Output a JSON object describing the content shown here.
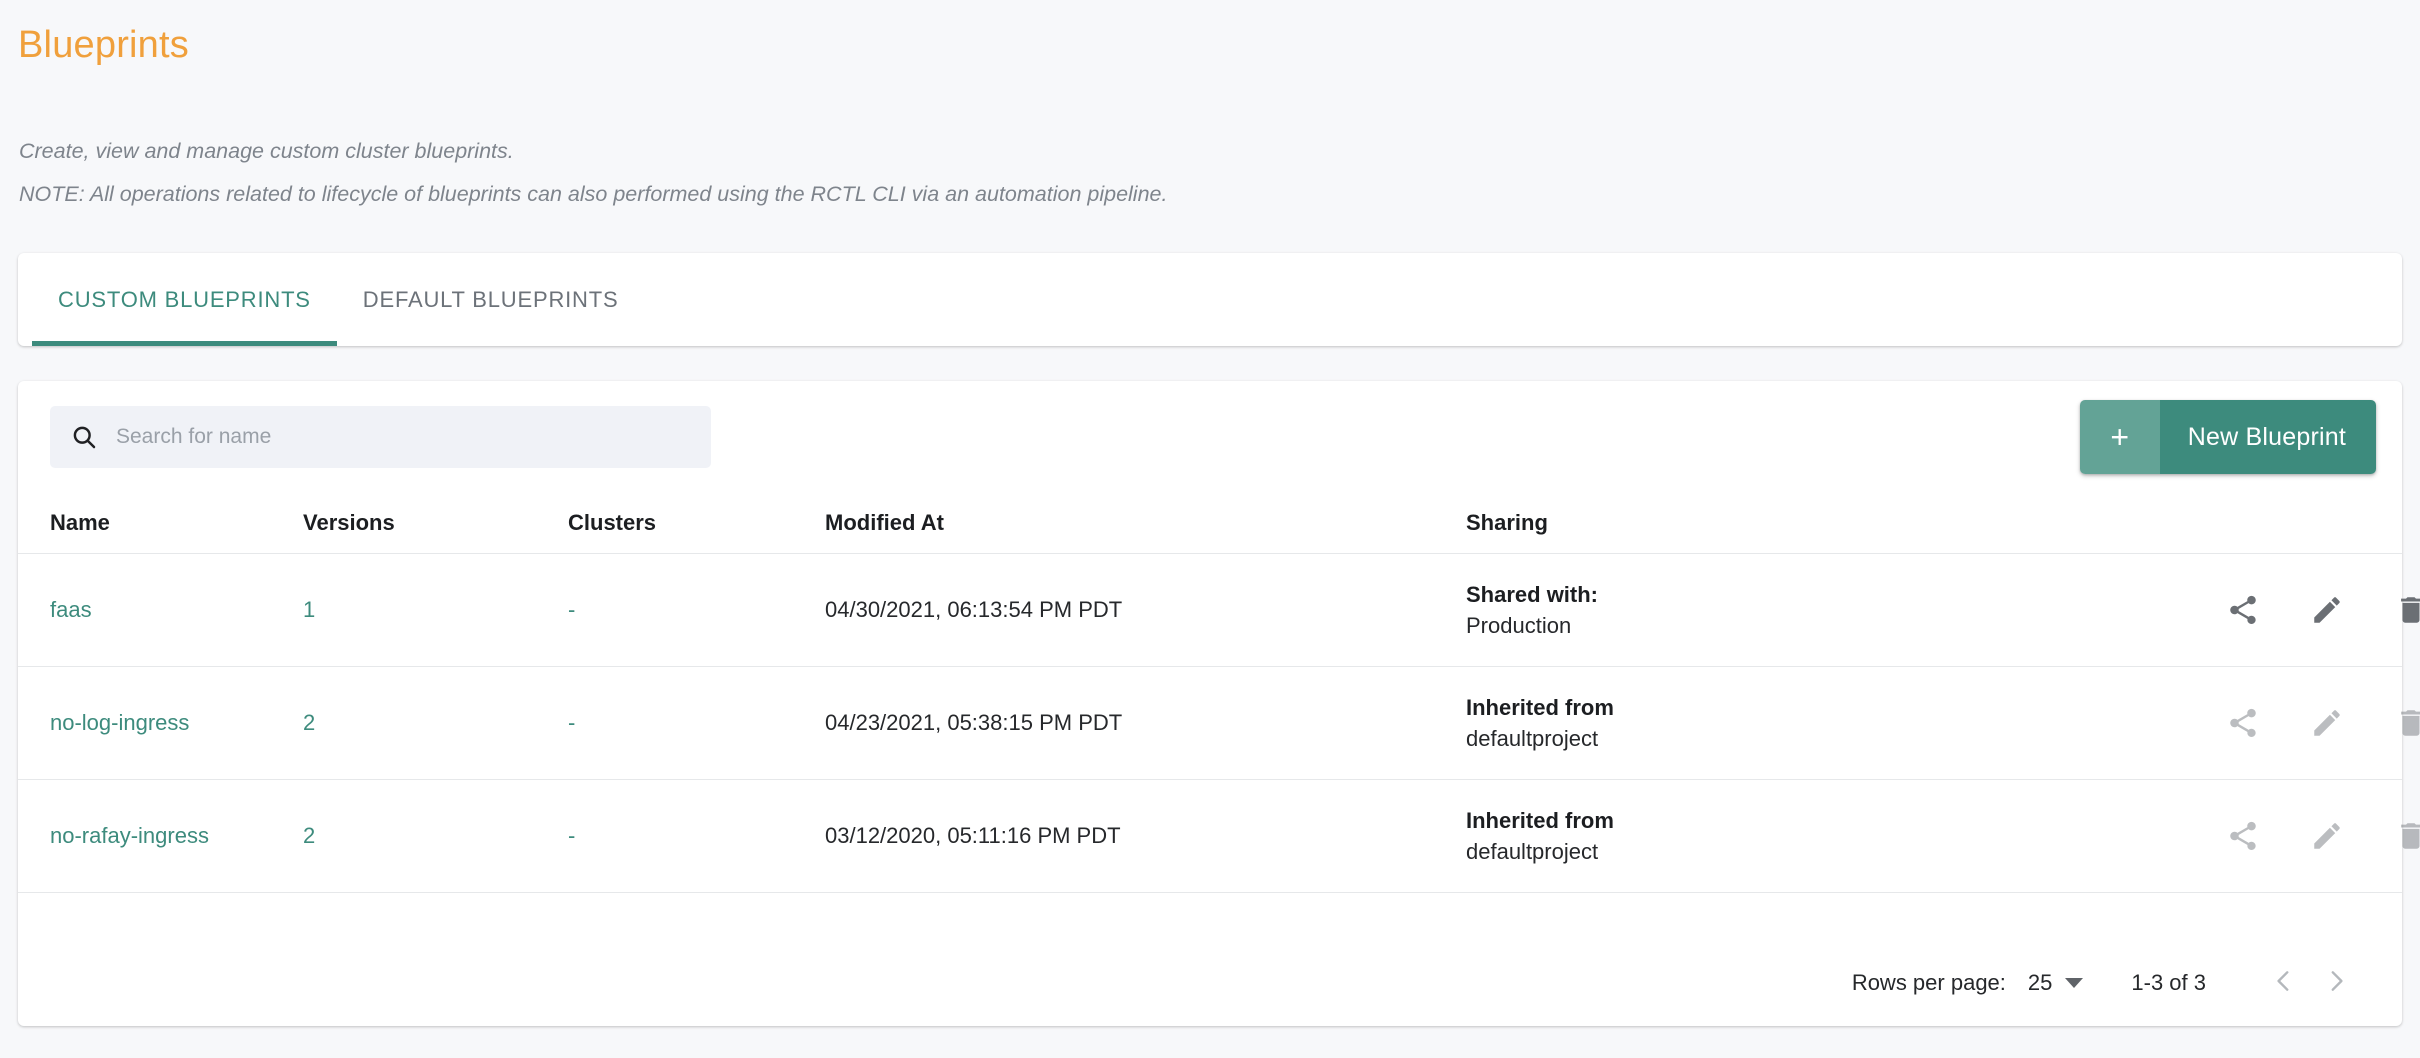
{
  "header": {
    "title": "Blueprints",
    "description_line1": "Create, view and manage custom cluster blueprints.",
    "description_line2": "NOTE: All operations related to lifecycle of blueprints can also performed using the RCTL CLI via an automation pipeline."
  },
  "tabs": [
    {
      "label": "CUSTOM BLUEPRINTS",
      "active": true
    },
    {
      "label": "DEFAULT BLUEPRINTS",
      "active": false
    }
  ],
  "toolbar": {
    "search_placeholder": "Search for name",
    "search_value": "",
    "search_icon": "search-icon",
    "new_button_plus": "+",
    "new_button_label": "New Blueprint"
  },
  "table": {
    "columns": [
      "Name",
      "Versions",
      "Clusters",
      "Modified At",
      "Sharing"
    ],
    "rows": [
      {
        "name": "faas",
        "versions": "1",
        "clusters": "-",
        "modified_at": "04/30/2021, 06:13:54 PM PDT",
        "sharing_title": "Shared with:",
        "sharing_value": "Production",
        "actions_enabled": true
      },
      {
        "name": "no-log-ingress",
        "versions": "2",
        "clusters": "-",
        "modified_at": "04/23/2021, 05:38:15 PM PDT",
        "sharing_title": "Inherited from",
        "sharing_value": "defaultproject",
        "actions_enabled": false
      },
      {
        "name": "no-rafay-ingress",
        "versions": "2",
        "clusters": "-",
        "modified_at": "03/12/2020, 05:11:16 PM PDT",
        "sharing_title": "Inherited from",
        "sharing_value": "defaultproject",
        "actions_enabled": false
      }
    ],
    "action_icons": [
      "share-icon",
      "edit-pencil-icon",
      "delete-trash-icon"
    ]
  },
  "footer": {
    "rows_per_page_label": "Rows per page:",
    "rows_per_page_value": "25",
    "range_label": "1-3 of 3",
    "prev_icon": "chevron-left-icon",
    "next_icon": "chevron-right-icon"
  },
  "colors": {
    "accent_teal": "#3d8b7d",
    "accent_teal_light": "#63a396",
    "title_orange": "#f0a03c",
    "page_background": "#f7f8fa",
    "card_background": "#ffffff",
    "search_background": "#f0f2f7",
    "text_primary": "#26282b",
    "text_muted": "#7e848c",
    "divider": "#e6e8ea"
  }
}
